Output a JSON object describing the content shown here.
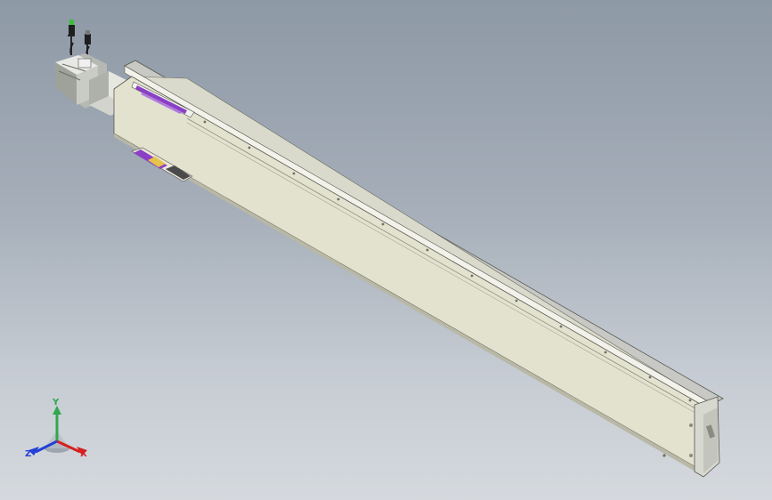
{
  "viewport": {
    "background_top": "#8e99a6",
    "background_bottom": "#d5d9de"
  },
  "model": {
    "name": "linear-actuator",
    "body_color": "#e3e2cf",
    "rail_color": "#c8c9c4",
    "accent_color": "#8a3fc4",
    "motor_color": "#d9dad5"
  },
  "triad": {
    "x_label": "X",
    "y_label": "Y",
    "z_label": "Z",
    "x_color": "#d62020",
    "y_color": "#2fa84f",
    "z_color": "#2340d8"
  }
}
